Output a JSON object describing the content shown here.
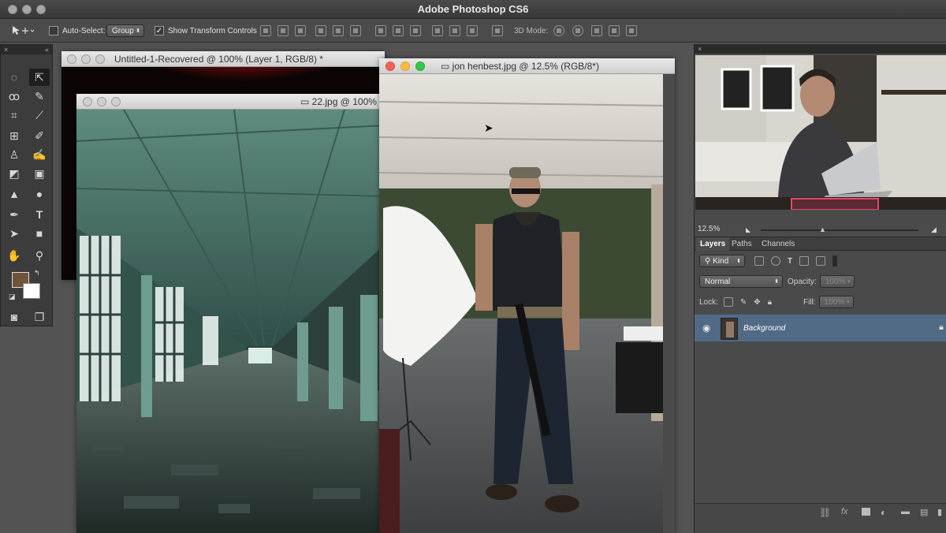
{
  "app": {
    "title": "Adobe Photoshop CS6"
  },
  "options_bar": {
    "auto_select_label": "Auto-Select:",
    "auto_select_value": "Group",
    "show_transform_label": "Show Transform Controls",
    "mode_3d_label": "3D Mode:"
  },
  "documents": [
    {
      "title": "Untitled-1-Recovered @ 100% (Layer 1, RGB/8) *"
    },
    {
      "title": "22.jpg @ 100%"
    },
    {
      "title": "jon henbest.jpg @ 12.5% (RGB/8*)"
    }
  ],
  "navigator": {
    "zoom": "12.5%"
  },
  "layers_panel": {
    "tabs": [
      "Layers",
      "Paths",
      "Channels"
    ],
    "filter_kind": "Kind",
    "blend_mode": "Normal",
    "opacity_label": "Opacity:",
    "opacity_value": "100%",
    "lock_label": "Lock:",
    "fill_label": "Fill:",
    "fill_value": "100%",
    "layers": [
      {
        "name": "Background"
      }
    ]
  },
  "colors": {
    "foreground": "#6e5537",
    "background": "#ffffff",
    "selected_layer": "#516a85",
    "close_button": "#fc605b",
    "minimize_button": "#fdbc40",
    "zoom_button": "#34c84a"
  },
  "icons": {
    "tools": [
      "move-icon",
      "marquee-icon",
      "lasso-icon",
      "quick-select-icon",
      "crop-icon",
      "eyedropper-icon",
      "spot-heal-icon",
      "brush-icon",
      "stamp-icon",
      "history-brush-icon",
      "eraser-icon",
      "gradient-icon",
      "blur-icon",
      "dodge-icon",
      "pen-icon",
      "type-icon",
      "path-select-icon",
      "shape-icon",
      "hand-icon",
      "zoom-icon"
    ]
  }
}
